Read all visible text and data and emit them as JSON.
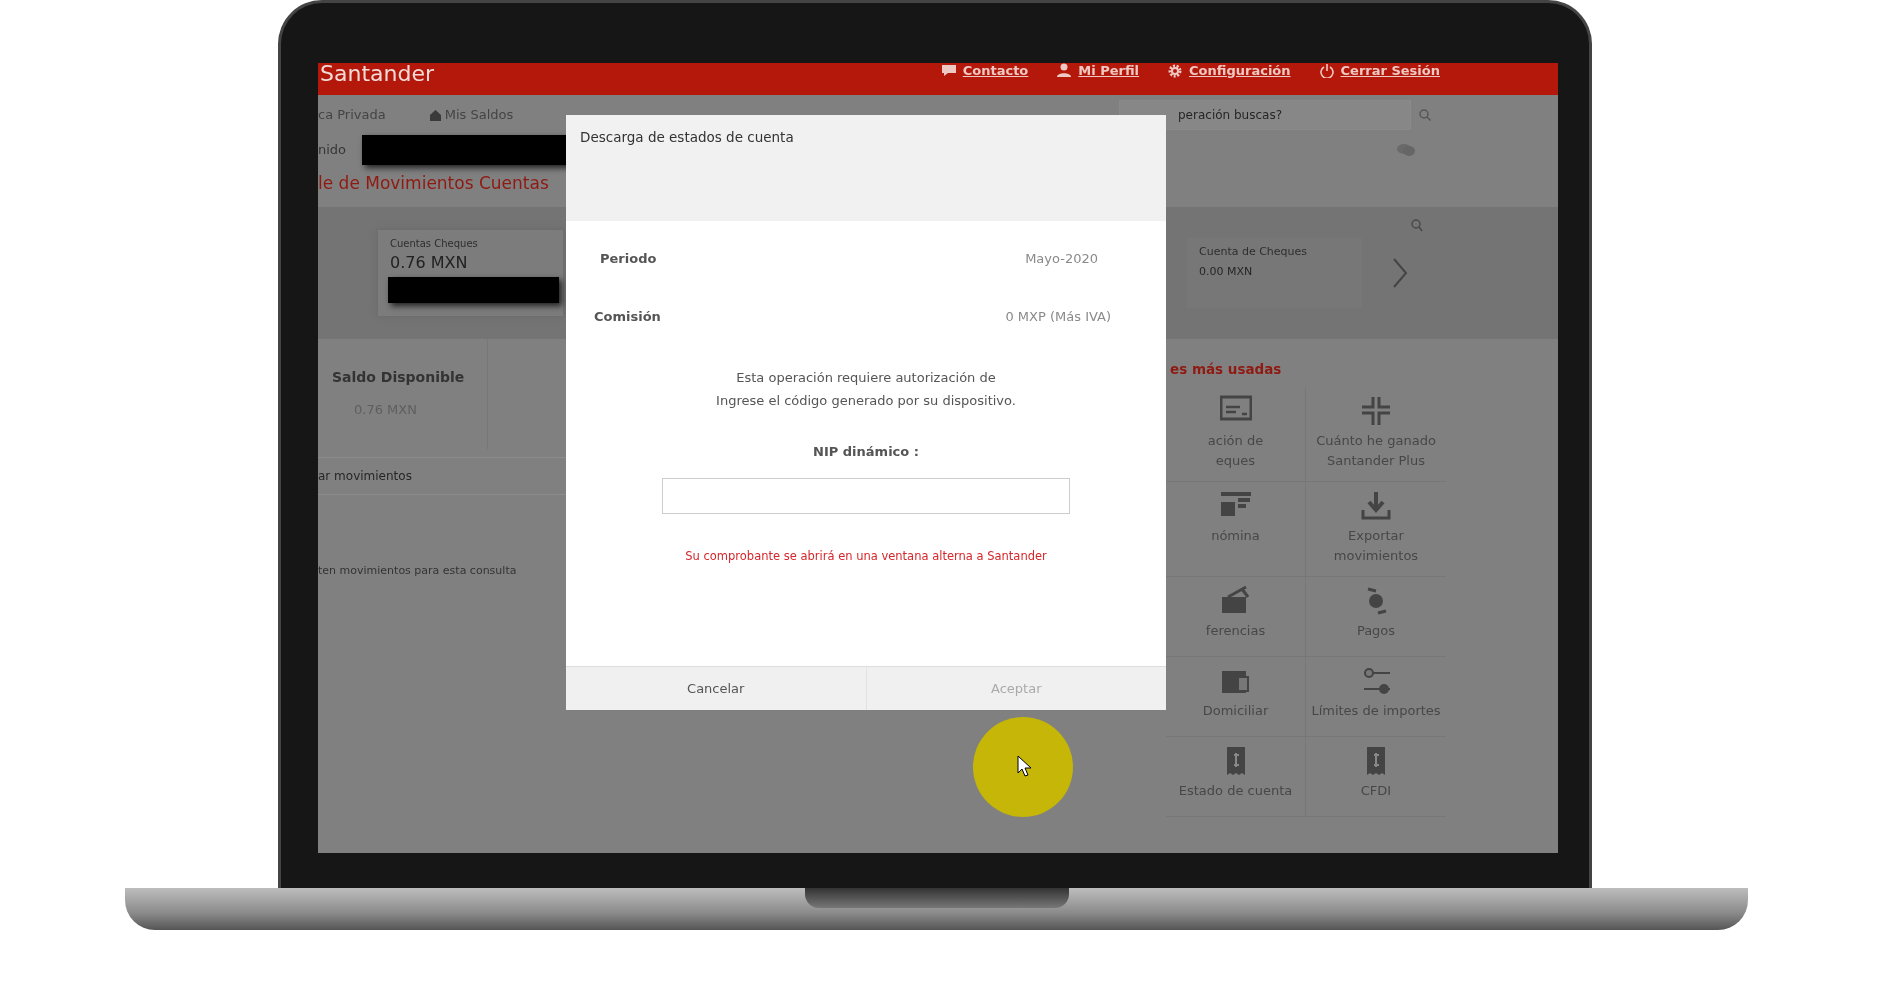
{
  "header": {
    "brand": "Santander",
    "links": [
      {
        "label": "Contacto"
      },
      {
        "label": "Mi Perfil"
      },
      {
        "label": "Configuración"
      },
      {
        "label": "Cerrar Sesión"
      }
    ]
  },
  "nav": {
    "tabs": [
      {
        "label": "ca Privada"
      },
      {
        "label": "Mis Saldos"
      }
    ],
    "search": {
      "placeholder": "peración buscas?"
    }
  },
  "greeting": "nido",
  "page_title": "le de Movimientos Cuentas",
  "accounts": [
    {
      "name": "Cuentas Cheques",
      "balance": "0.76 MXN"
    },
    {
      "name": "Cuenta de Cheques",
      "balance": "0.00 MXN"
    }
  ],
  "summary": {
    "label": "Saldo Disponible",
    "value": "0.76 MXN"
  },
  "filter": "ar movimientos",
  "empty_message": "ten movimientos para esta consulta",
  "operations": {
    "title": "es más usadas",
    "items": [
      {
        "label": "ación de\neques"
      },
      {
        "label": "Cuánto he ganado\nSantander Plus"
      },
      {
        "label": "nómina"
      },
      {
        "label": "Exportar movimientos"
      },
      {
        "label": "ferencias"
      },
      {
        "label": "Pagos"
      },
      {
        "label": "Domiciliar"
      },
      {
        "label": "Límites de importes"
      },
      {
        "label": "Estado de cuenta"
      },
      {
        "label": "CFDI"
      }
    ]
  },
  "modal": {
    "title": "Descarga de estados de cuenta",
    "fields": [
      {
        "label": "Periodo",
        "value": "Mayo-2020"
      },
      {
        "label": "Comisión",
        "value": "0 MXP (Más IVA)"
      }
    ],
    "message": "Esta operación requiere autorización de\nIngrese el código generado por su dispositivo.",
    "pin_label": "NIP dinámico :",
    "notice": "Su comprobante se abrirá en una ventana alterna a Santander",
    "buttons": [
      {
        "label": "Cancelar",
        "disabled": false
      },
      {
        "label": "Aceptar",
        "disabled": true
      }
    ]
  }
}
